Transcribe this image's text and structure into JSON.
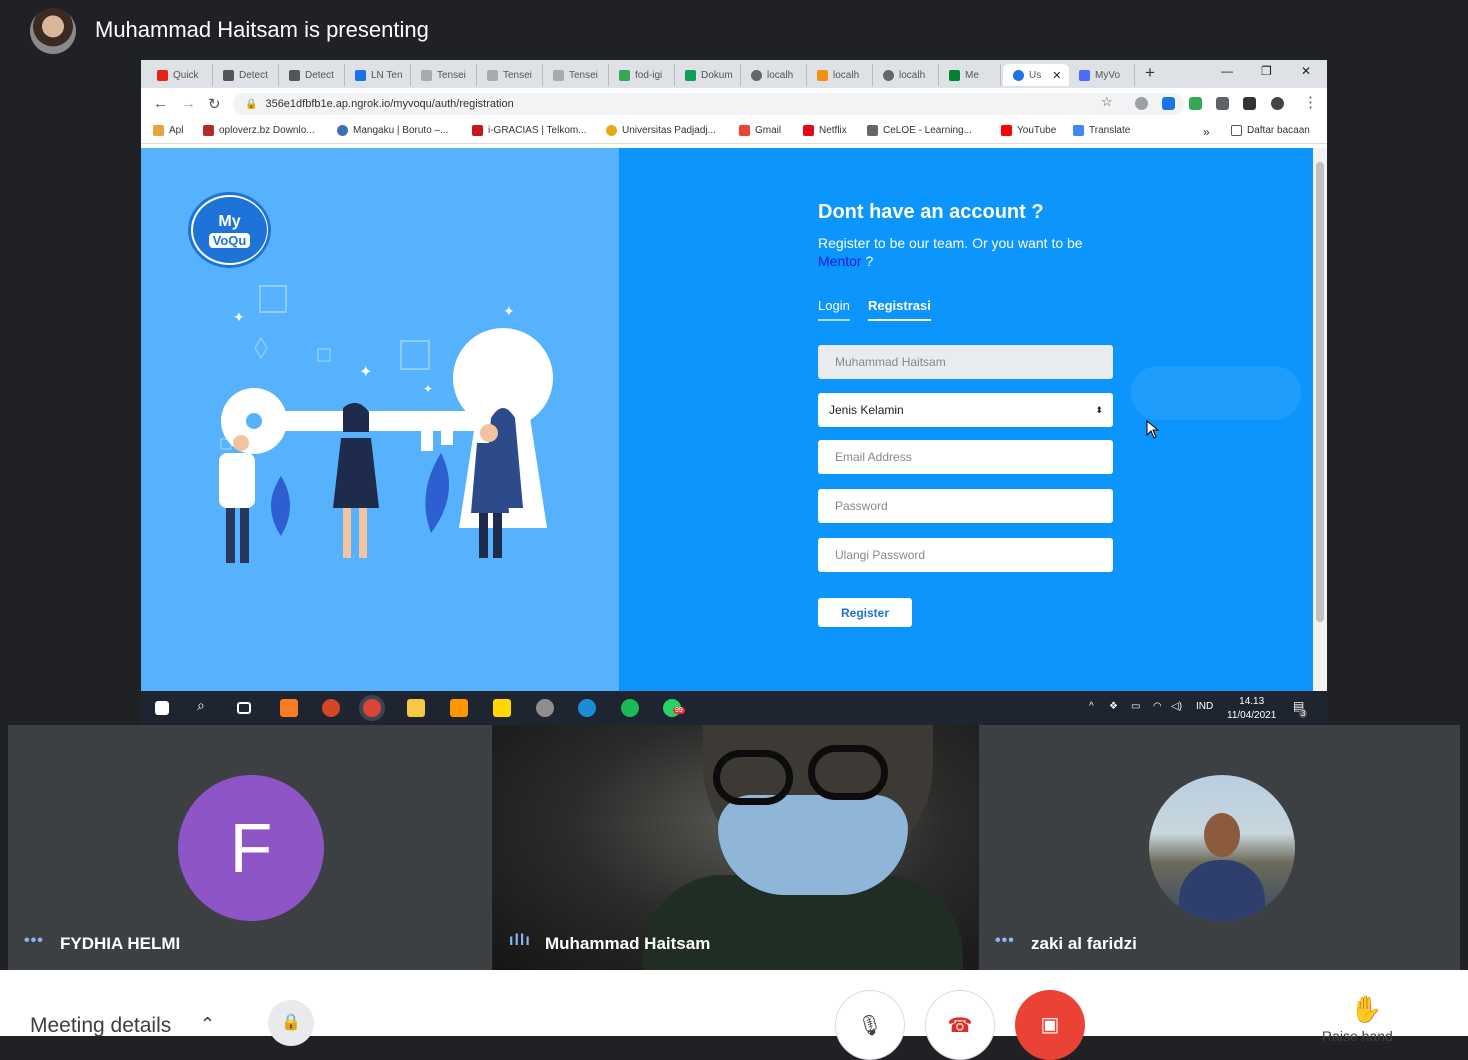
{
  "meet": {
    "presenting_title": "Muhammad Haitsam is presenting",
    "participants": [
      {
        "name": "FYDHIA HELMI",
        "initial": "F"
      },
      {
        "name": "Muhammad Haitsam"
      },
      {
        "name": "zaki al faridzi"
      }
    ],
    "bottom": {
      "meeting_details": "Meeting details",
      "raise_hand_label": "Raise hand"
    }
  },
  "browser": {
    "tabs": [
      "Quick",
      "Detect",
      "Detect",
      "LN Ten",
      "Tensei",
      "Tensei",
      "Tensei",
      "fod-igi",
      "Dokum",
      "localh",
      "localh",
      "localh",
      "Me",
      "Us",
      "MyVo"
    ],
    "url": "356e1dfbfb1e.ap.ngrok.io/myvoqu/auth/registration",
    "bookmarks": [
      "Apl",
      "oploverz.bz Downlo...",
      "Mangaku | Boruto –...",
      "i-GRACIAS | Telkom...",
      "Universitas Padjadj...",
      "Gmail",
      "Netflix",
      "CeLOE - Learning...",
      "YouTube",
      "Translate"
    ],
    "bookmarks_more": "»",
    "reading_list": "Daftar bacaan"
  },
  "page": {
    "logo_line1": "My",
    "logo_line2": "VoQu",
    "heading": "Dont have an account ?",
    "subtext": "Register to be our team. Or you want to be ",
    "mentor_link": "Mentor",
    "subtext_end": " ?",
    "tabs": {
      "login": "Login",
      "register": "Registrasi"
    },
    "form": {
      "name_value": "Muhammad Haitsam",
      "gender_value": "Jenis Kelamin",
      "email_placeholder": "Email Address",
      "password_placeholder": "Password",
      "repassword_placeholder": "Ulangi Password",
      "submit": "Register"
    }
  },
  "taskbar": {
    "time": "14.13",
    "date": "11/04/2021",
    "lang": "IND",
    "notification_count": "3",
    "whatsapp_badge": "99"
  }
}
